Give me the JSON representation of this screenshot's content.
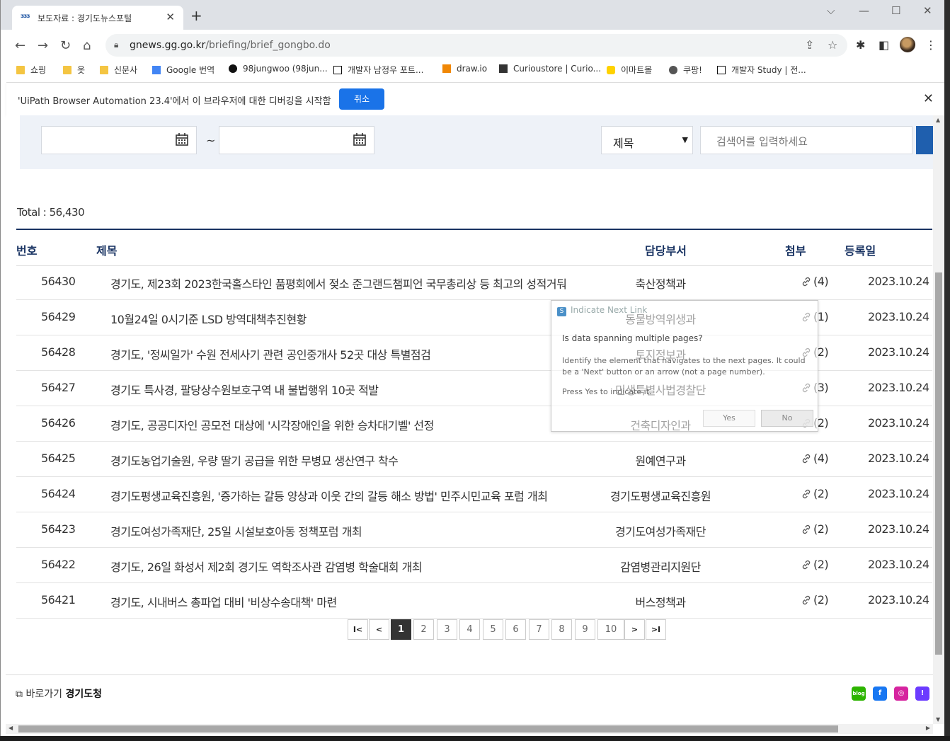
{
  "browser": {
    "tab_title": "보도자료 : 경기도뉴스포털",
    "tab_favicon": "ᴣᴣᴣ",
    "url_domain": "gnews.gg.go.kr",
    "url_path": "/briefing/brief_gongbo.do",
    "bookmarks": [
      {
        "label": "쇼핑",
        "icon": "folder-icon"
      },
      {
        "label": "옷",
        "icon": "folder-icon"
      },
      {
        "label": "신문사",
        "icon": "folder-icon"
      },
      {
        "label": "Google 번역",
        "icon": "translate-icon"
      },
      {
        "label": "98jungwoo (98jun...",
        "icon": "github-icon"
      },
      {
        "label": "개발자 남정우 포트...",
        "icon": "notion-icon"
      },
      {
        "label": "draw.io",
        "icon": "drawio-icon"
      },
      {
        "label": "Curioustore | Curio...",
        "icon": "question-icon"
      },
      {
        "label": "이마트몰",
        "icon": "emart-icon"
      },
      {
        "label": "쿠팡!",
        "icon": "globe-icon"
      },
      {
        "label": "개발자 Study | 전...",
        "icon": "notion-icon"
      }
    ],
    "infobar_message": "'UiPath Browser Automation 23.4'에서 이 브라우저에 대한 디버깅을 시작함",
    "infobar_button": "취소"
  },
  "search": {
    "tilde": "~",
    "field_select": "제목",
    "keyword_placeholder": "검색어를 입력하세요"
  },
  "total_label": "Total : 56,430",
  "table": {
    "headers": {
      "no": "번호",
      "title": "제목",
      "dept": "담당부서",
      "attach": "첨부",
      "date": "등록일"
    },
    "rows": [
      {
        "no": "56430",
        "title": "경기도, 제23회 2023한국홀스타인 품평회에서 젖소 준그랜드챔피언 국무총리상 등 최고의 성적거둬",
        "dept": "축산정책과",
        "attach": "(4)",
        "date": "2023.10.24"
      },
      {
        "no": "56429",
        "title": "10월24일 0시기준 LSD 방역대책추진현황",
        "dept": "동물방역위생과",
        "attach": "(1)",
        "date": "2023.10.24"
      },
      {
        "no": "56428",
        "title": "경기도, '정씨일가' 수원 전세사기 관련 공인중개사 52곳 대상 특별점검",
        "dept": "토지정보과",
        "attach": "(2)",
        "date": "2023.10.24"
      },
      {
        "no": "56427",
        "title": "경기도 특사경, 팔당상수원보호구역 내 불법행위 10곳 적발",
        "dept": "민생특별사법경찰단",
        "attach": "(3)",
        "date": "2023.10.24"
      },
      {
        "no": "56426",
        "title": "경기도, 공공디자인 공모전 대상에 '시각장애인을 위한 승차대기벨' 선정",
        "dept": "건축디자인과",
        "attach": "(2)",
        "date": "2023.10.24"
      },
      {
        "no": "56425",
        "title": "경기도농업기술원, 우량 딸기 공급을 위한 무병묘 생산연구 착수",
        "dept": "원예연구과",
        "attach": "(4)",
        "date": "2023.10.24"
      },
      {
        "no": "56424",
        "title": "경기도평생교육진흥원, '증가하는 갈등 양상과 이웃 간의 갈등 해소 방법' 민주시민교육 포럼 개최",
        "dept": "경기도평생교육진흥원",
        "attach": "(2)",
        "date": "2023.10.24"
      },
      {
        "no": "56423",
        "title": "경기도여성가족재단, 25일 시설보호아동 정책포럼 개최",
        "dept": "경기도여성가족재단",
        "attach": "(2)",
        "date": "2023.10.24"
      },
      {
        "no": "56422",
        "title": "경기도, 26일 화성서 제2회 경기도 역학조사관 감염병 학술대회 개최",
        "dept": "감염병관리지원단",
        "attach": "(2)",
        "date": "2023.10.24"
      },
      {
        "no": "56421",
        "title": "경기도, 시내버스 총파업 대비 '비상수송대책' 마련",
        "dept": "버스정책과",
        "attach": "(2)",
        "date": "2023.10.24"
      }
    ]
  },
  "pagination": {
    "first": "I<",
    "prev": "<",
    "next": ">",
    "last": ">I",
    "pages": [
      "1",
      "2",
      "3",
      "4",
      "5",
      "6",
      "7",
      "8",
      "9",
      "10"
    ],
    "current": "1"
  },
  "footer": {
    "shortcut_prefix": "바로가기",
    "shortcut_target": "경기도청",
    "sns": [
      {
        "name": "blog",
        "label": "blog",
        "color": "#2db400"
      },
      {
        "name": "facebook",
        "label": "f",
        "color": "#1877f2"
      },
      {
        "name": "instagram",
        "label": "◎",
        "color": "#d6249f"
      },
      {
        "name": "kakaostory",
        "label": "!",
        "color": "#6b3bff"
      }
    ]
  },
  "dialog": {
    "header": "Indicate Next Link",
    "question": "Is data spanning multiple pages?",
    "description": "Identify the element that navigates to the next pages. It could be a 'Next' button or an arrow (not a page number).",
    "press": "Press Yes to indicate it.",
    "yes": "Yes",
    "no": "No"
  },
  "colors": {
    "accent": "#1a3463",
    "button_blue": "#1a73e8",
    "search_blue": "#1f5fae"
  }
}
